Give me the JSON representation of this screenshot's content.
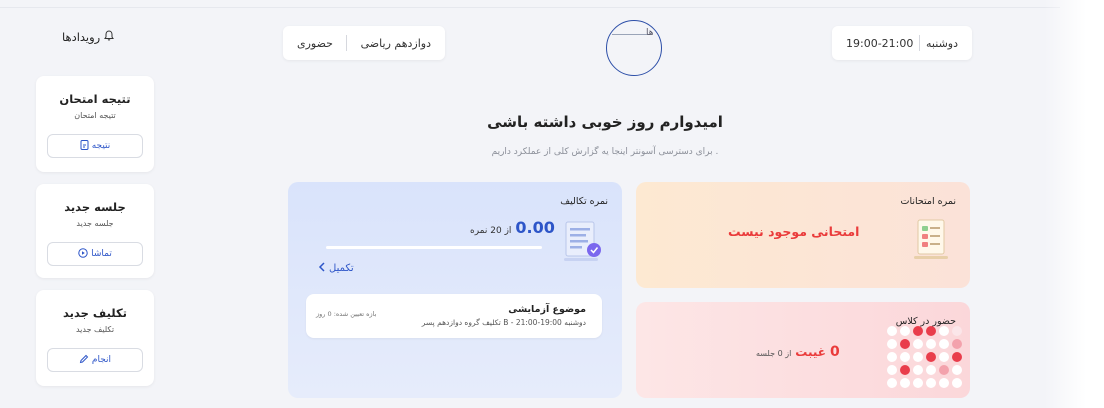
{
  "events": {
    "label": "رویدادها",
    "icon": "bell-icon"
  },
  "topbar": {
    "class_name": "دوازدهم ریاضی",
    "mode": "حضوری",
    "day": "دوشنبه",
    "time": "19:00-21:00"
  },
  "sidebar": {
    "cards": [
      {
        "title": "تتیجه امتحان",
        "subtitle": "تتیجه امتحان",
        "button": "نتیجه",
        "icon": "document-icon"
      },
      {
        "title": "جلسه جدید",
        "subtitle": "جلسه جدید",
        "button": "تماشا",
        "icon": "play-circle-icon"
      },
      {
        "title": "تکلیف جدید",
        "subtitle": "تکلیف جدید",
        "button": "انجام",
        "icon": "pen-icon"
      }
    ]
  },
  "hero": {
    "title": "امیدوارم روز خوبی داشته باشی",
    "subtitle": "برای دسترسی آسونتر اینجا یه گزارش کلی از عملکرد داریم ."
  },
  "assignments": {
    "title": "نمره تکالیف",
    "score": "0.00",
    "score_suffix": "از 20 نمره",
    "progress": 0,
    "complete_label": "تکمیل",
    "task": {
      "title": "موضوع آزمایشی",
      "meta": "تکلیف گروه دوازدهم پسر B - دوشنبه 19:00-21:00",
      "due": "بازه تعیین شده: 0 روز"
    }
  },
  "exams": {
    "title": "نمره امتحانات",
    "message": "امتحانی موجود نیست"
  },
  "attendance": {
    "title": "حضور در کلاس",
    "absence_count": "0",
    "absence_word": "غیبت",
    "absence_rest": "از 0 جلسه"
  },
  "colors": {
    "accent": "#2d55c8",
    "danger": "#ea3b3b"
  }
}
